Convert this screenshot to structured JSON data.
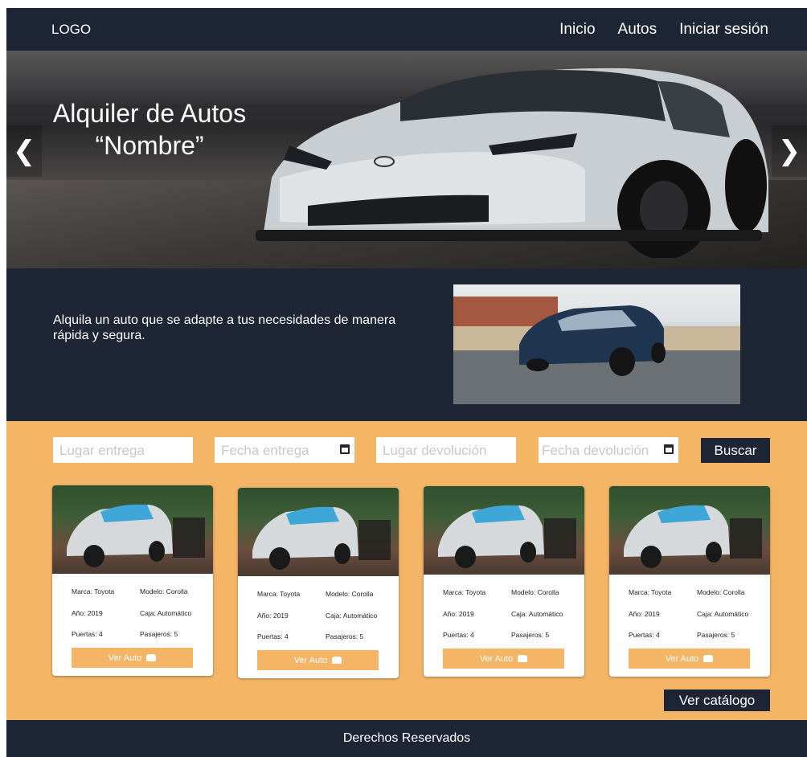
{
  "nav": {
    "logo": "LOGO",
    "links": [
      "Inicio",
      "Autos",
      "Iniciar sesión"
    ]
  },
  "hero": {
    "title_line1": "Alquiler de Autos",
    "title_line2": "“Nombre”",
    "prev_icon": "chevron-left-icon",
    "next_icon": "chevron-right-icon"
  },
  "intro": {
    "text": "Alquila un auto que se adapte a tus necesidades de manera rápida y segura."
  },
  "search": {
    "pickup_place_placeholder": "Lugar entrega",
    "pickup_date_placeholder": "Fecha entrega",
    "return_place_placeholder": "Lugar devolución",
    "return_date_placeholder": "Fecha devolución",
    "button": "Buscar",
    "calendar_icon": "calendar-icon"
  },
  "cards": [
    {
      "marca": "Marca: Toyota",
      "modelo": "Modelo: Corolla",
      "anio": "Año: 2019",
      "caja": "Caja: Automático",
      "puertas": "Puertas: 4",
      "pasajeros": "Pasajeros: 5",
      "button": "Ver Auto"
    },
    {
      "marca": "Marca: Toyota",
      "modelo": "Modelo: Corolla",
      "anio": "Año: 2019",
      "caja": "Caja: Automático",
      "puertas": "Puertas: 4",
      "pasajeros": "Pasajeros: 5",
      "button": "Ver Auto"
    },
    {
      "marca": "Marca: Toyota",
      "modelo": "Modelo: Corolla",
      "anio": "Año: 2019",
      "caja": "Caja: Automático",
      "puertas": "Puertas: 4",
      "pasajeros": "Pasajeros: 5",
      "button": "Ver Auto"
    },
    {
      "marca": "Marca: Toyota",
      "modelo": "Modelo: Corolla",
      "anio": "Año: 2019",
      "caja": "Caja: Automático",
      "puertas": "Puertas: 4",
      "pasajeros": "Pasajeros: 5",
      "button": "Ver Auto"
    }
  ],
  "catalog_button": "Ver catálogo",
  "footer": {
    "text": "Derechos Reservados"
  },
  "colors": {
    "navy": "#1e2535",
    "orange": "#f5b567",
    "white": "#ffffff"
  }
}
